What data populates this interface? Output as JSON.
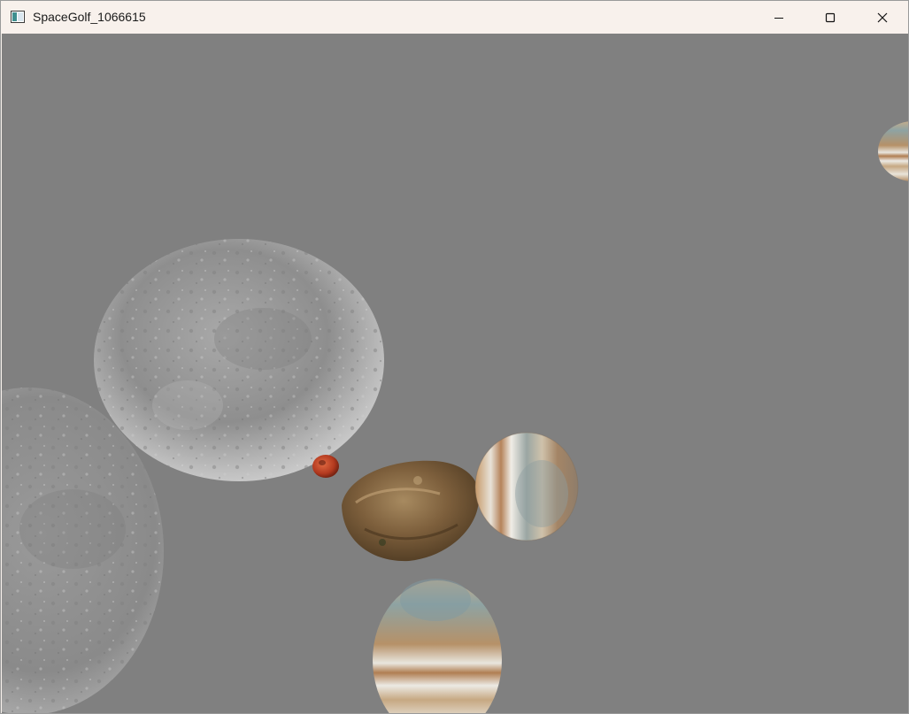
{
  "window": {
    "title": "SpaceGolf_1066615",
    "controls": {
      "minimize_icon": "minimize-icon",
      "maximize_icon": "maximize-icon",
      "close_icon": "close-icon"
    }
  },
  "scene": {
    "background_color": "#808080",
    "objects": [
      {
        "kind": "planet",
        "texture": "grey-cratered-moon",
        "name": "large-grey-moon"
      },
      {
        "kind": "planet",
        "texture": "grey-cratered-moon",
        "name": "grey-moon-left-edge"
      },
      {
        "kind": "ball",
        "texture": "red-mars",
        "name": "golf-ball"
      },
      {
        "kind": "asteroid",
        "texture": "brown-rock",
        "name": "rock-asteroid"
      },
      {
        "kind": "planet",
        "texture": "banded-jupiter",
        "name": "jupiter-planet-center"
      },
      {
        "kind": "planet",
        "texture": "banded-jupiter",
        "name": "jupiter-planet-bottom"
      },
      {
        "kind": "planet",
        "texture": "banded-jupiter",
        "name": "jupiter-planet-right-edge"
      }
    ]
  }
}
